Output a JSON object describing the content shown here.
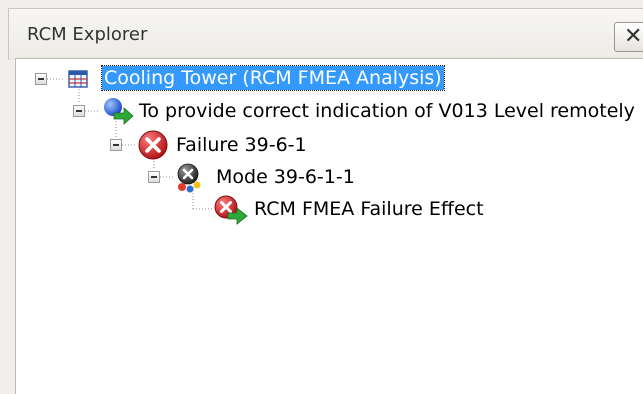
{
  "window": {
    "title": "RCM Explorer",
    "close_glyph": "✕"
  },
  "tree": {
    "root": {
      "label": "Cooling Tower (RCM FMEA Analysis)",
      "icon": "analysis-table-icon",
      "selected": true,
      "expanded": true
    },
    "function": {
      "label": "To provide correct indication of V013 Level remotely",
      "icon": "function-icon",
      "expanded": true
    },
    "failure": {
      "label": "Failure 39-6-1",
      "icon": "failure-icon",
      "expanded": true
    },
    "mode": {
      "label": "Mode 39-6-1-1",
      "icon": "failure-mode-icon",
      "expanded": true
    },
    "effect": {
      "label": "RCM FMEA Failure Effect",
      "icon": "failure-effect-icon"
    }
  },
  "colors": {
    "selection": "#3399ff",
    "failure_red": "#d9262a"
  }
}
